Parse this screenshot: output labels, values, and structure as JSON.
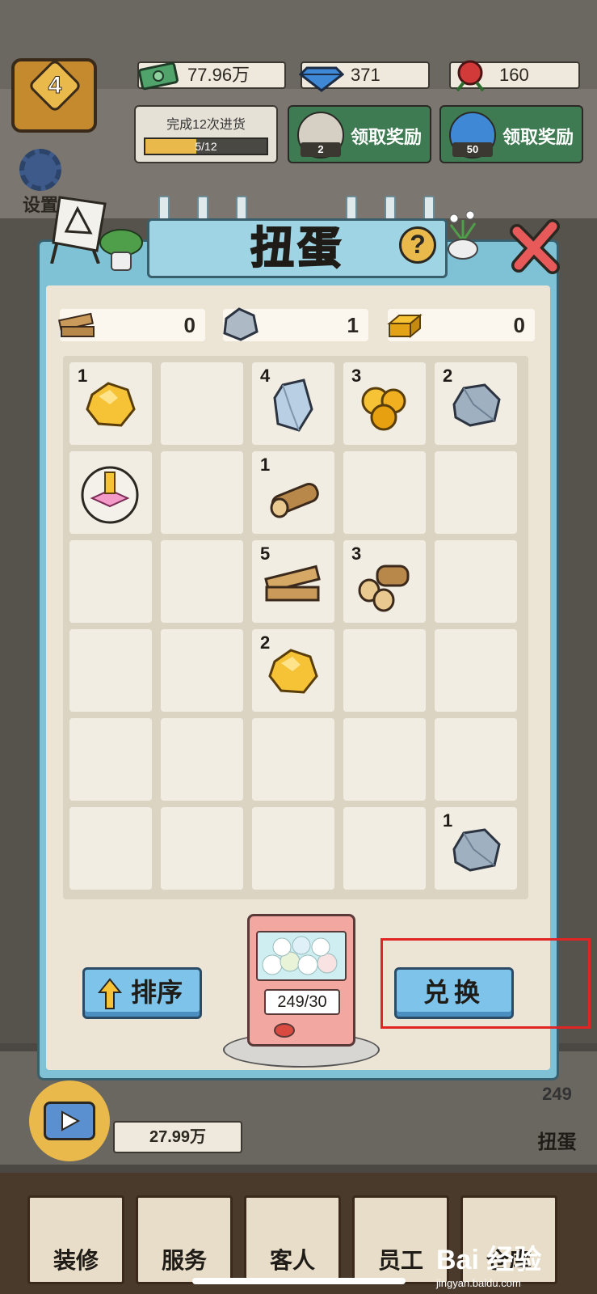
{
  "hud": {
    "level": "4",
    "money": "77.96万",
    "diamonds": "371",
    "roses": "160"
  },
  "task": {
    "title": "完成12次进货",
    "progress_text": "5/12",
    "progress": 0.4167
  },
  "rewards": [
    {
      "label": "领取奖励",
      "count": "2"
    },
    {
      "label": "领取奖励",
      "count": "50"
    }
  ],
  "side_menu": {
    "settings": "设置"
  },
  "dialog": {
    "title": "扭蛋",
    "help": "?"
  },
  "currencies": [
    {
      "icon": "wood-plank-icon",
      "value": "0"
    },
    {
      "icon": "silver-ore-icon",
      "value": "1"
    },
    {
      "icon": "gold-bar-icon",
      "value": "0"
    }
  ],
  "inventory": [
    {
      "count": "1",
      "icon": "gold-nugget-icon"
    },
    {
      "count": "",
      "icon": ""
    },
    {
      "count": "4",
      "icon": "crystal-icon"
    },
    {
      "count": "3",
      "icon": "gold-ore-icon"
    },
    {
      "count": "2",
      "icon": "stone-icon"
    },
    {
      "count": "",
      "icon": "gift-capsule-icon"
    },
    {
      "count": "",
      "icon": ""
    },
    {
      "count": "1",
      "icon": "log-icon"
    },
    {
      "count": "",
      "icon": ""
    },
    {
      "count": "",
      "icon": ""
    },
    {
      "count": "",
      "icon": ""
    },
    {
      "count": "",
      "icon": ""
    },
    {
      "count": "5",
      "icon": "planks-icon"
    },
    {
      "count": "3",
      "icon": "log-pile-icon"
    },
    {
      "count": "",
      "icon": ""
    },
    {
      "count": "",
      "icon": ""
    },
    {
      "count": "",
      "icon": ""
    },
    {
      "count": "2",
      "icon": "gold-nugget-icon"
    },
    {
      "count": "",
      "icon": ""
    },
    {
      "count": "",
      "icon": ""
    },
    {
      "count": "",
      "icon": ""
    },
    {
      "count": "",
      "icon": ""
    },
    {
      "count": "",
      "icon": ""
    },
    {
      "count": "",
      "icon": ""
    },
    {
      "count": "",
      "icon": ""
    },
    {
      "count": "",
      "icon": ""
    },
    {
      "count": "",
      "icon": ""
    },
    {
      "count": "",
      "icon": ""
    },
    {
      "count": "",
      "icon": ""
    },
    {
      "count": "1",
      "icon": "stone-icon"
    }
  ],
  "actions": {
    "sort": "排序",
    "exchange": "兑换"
  },
  "machine": {
    "count": "249/30"
  },
  "lower": {
    "coins": "27.99万",
    "gacha_count": "249",
    "gacha_label": "扭蛋"
  },
  "nav": [
    {
      "label": "装修"
    },
    {
      "label": "服务"
    },
    {
      "label": "客人"
    },
    {
      "label": "员工"
    },
    {
      "label": "仓库"
    }
  ],
  "colors": {
    "dialog_frame": "#7fc2d6",
    "panel": "#ece5d6",
    "button_blue": "#7ec3ea",
    "highlight": "#e02525"
  },
  "watermark": {
    "brand": "Bai 经验",
    "url": "jingyan.baidu.com"
  }
}
